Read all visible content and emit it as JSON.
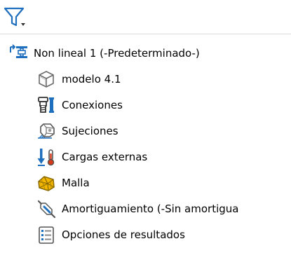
{
  "toolbar": {
    "filter_icon": "filter-dropdown-icon"
  },
  "tree": {
    "root": {
      "label": "Non lineal 1 (-Predeterminado-)",
      "icon": "study-root-icon"
    },
    "children": [
      {
        "label": "modelo 4.1",
        "icon": "part-body-icon"
      },
      {
        "label": "Conexiones",
        "icon": "connections-icon"
      },
      {
        "label": "Sujeciones",
        "icon": "fixtures-icon"
      },
      {
        "label": "Cargas externas",
        "icon": "external-loads-icon"
      },
      {
        "label": "Malla",
        "icon": "mesh-icon"
      },
      {
        "label": "Amortiguamiento (-Sin amortigua",
        "icon": "damping-icon"
      },
      {
        "label": "Opciones de resultados",
        "icon": "result-options-icon"
      }
    ]
  },
  "colors": {
    "icon_blue": "#1f6fbf",
    "icon_yellow": "#f2b600",
    "icon_gray": "#8a8a8a",
    "separator": "#d9d9d9"
  }
}
